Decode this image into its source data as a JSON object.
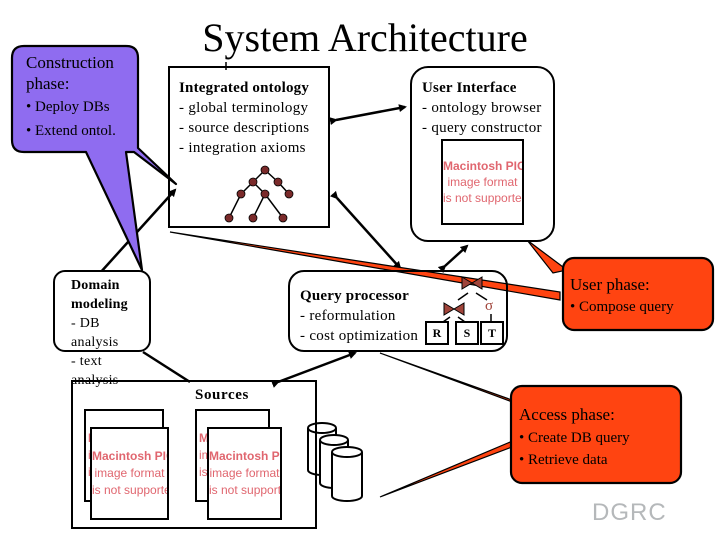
{
  "slide": {
    "title": "System Architecture",
    "logo_text": "DGRC"
  },
  "colors": {
    "construction_callout": "#8f6cf0",
    "phase_callout": "#ff4411",
    "pict_placeholder_text": "#e0666f",
    "tree_node": "#7a2a2a",
    "operator": "#a0443a"
  },
  "boxes": {
    "ontology": {
      "heading": "Integrated ontology",
      "lines": [
        "- global terminology",
        "- source descriptions",
        "- integration axioms"
      ],
      "icon": "tree-icon"
    },
    "user_interface": {
      "heading": "User Interface",
      "lines": [
        "- ontology browser",
        "- query constructor"
      ],
      "image_placeholder": [
        "Macintosh PICT",
        "image format",
        "is not supported"
      ]
    },
    "domain_modeling": {
      "heading": [
        "Domain",
        "modeling"
      ],
      "lines": [
        "- DB analysis",
        "- text analysis"
      ]
    },
    "query_processor": {
      "heading": "Query processor",
      "lines": [
        "- reformulation",
        "- cost optimization"
      ],
      "operators": {
        "join_symbol": "⋈",
        "select_symbol": "σ",
        "relations": [
          "R",
          "S",
          "T"
        ]
      }
    },
    "sources": {
      "label": "Sources",
      "image_placeholder": [
        "Macintosh PICT",
        "image format",
        "is not supported"
      ],
      "icon": "database-stack-icon"
    }
  },
  "callouts": {
    "construction": {
      "title": [
        "Construction",
        "phase:"
      ],
      "bullets": [
        "• Deploy DBs",
        "• Extend ontol."
      ]
    },
    "user": {
      "title": "User phase:",
      "bullets": [
        "• Compose query"
      ]
    },
    "access": {
      "title": "Access phase:",
      "bullets": [
        "• Create DB query",
        "• Retrieve data"
      ]
    }
  }
}
